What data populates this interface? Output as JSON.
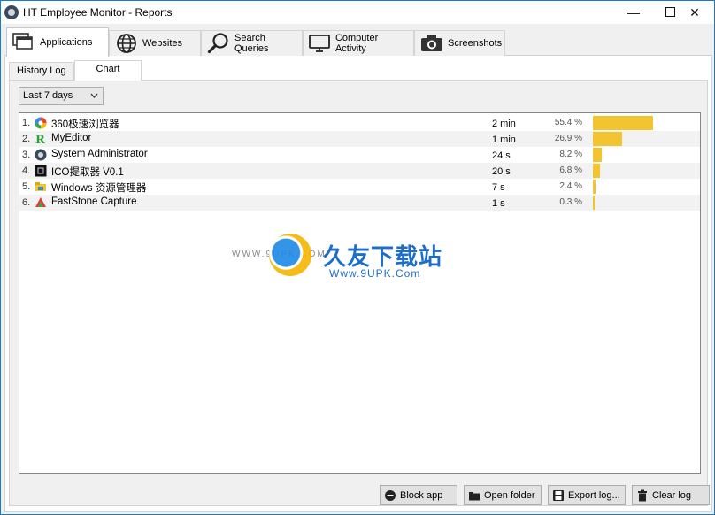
{
  "window": {
    "title": "HT Employee Monitor - Reports",
    "min_glyph": "—",
    "close_glyph": "✕"
  },
  "main_tabs": [
    {
      "label": "Applications",
      "icon": "windows-stack-icon"
    },
    {
      "label": "Websites",
      "icon": "globe-icon"
    },
    {
      "label": "Search Queries",
      "icon": "magnifier-icon"
    },
    {
      "label": "Computer Activity",
      "icon": "monitor-icon"
    },
    {
      "label": "Screenshots",
      "icon": "camera-icon"
    }
  ],
  "sub_tabs": [
    {
      "label": "History Log"
    },
    {
      "label": "Chart"
    }
  ],
  "period": {
    "selected": "Last 7 days"
  },
  "rows": [
    {
      "num": "1.",
      "name": "360极速浏览器",
      "time": "2 min",
      "pct": "55.4 %",
      "fraction": 0.554,
      "icon": "browser-360-icon"
    },
    {
      "num": "2.",
      "name": "MyEditor",
      "time": "1 min",
      "pct": "26.9 %",
      "fraction": 0.269,
      "icon": "myeditor-icon"
    },
    {
      "num": "3.",
      "name": "System Administrator",
      "time": "24 s",
      "pct": "8.2 %",
      "fraction": 0.082,
      "icon": "system-admin-icon"
    },
    {
      "num": "4.",
      "name": "ICO提取器 V0.1",
      "time": "20 s",
      "pct": "6.8 %",
      "fraction": 0.068,
      "icon": "ico-extractor-icon"
    },
    {
      "num": "5.",
      "name": "Windows 资源管理器",
      "time": "7 s",
      "pct": "2.4 %",
      "fraction": 0.024,
      "icon": "explorer-folder-icon"
    },
    {
      "num": "6.",
      "name": "FastStone Capture",
      "time": "1 s",
      "pct": "0.3 %",
      "fraction": 0.003,
      "icon": "faststone-icon"
    }
  ],
  "buttons": {
    "block_app": "Block app",
    "open_folder": "Open folder",
    "export_log": "Export log...",
    "clear_log": "Clear log"
  },
  "watermark": {
    "left_text": "WWW.9UPK.COM",
    "cn_text": "久友下载站",
    "url_text": "Www.9UPK.Com"
  },
  "colors": {
    "bar": "#f4c430",
    "accent": "#1979ca"
  }
}
